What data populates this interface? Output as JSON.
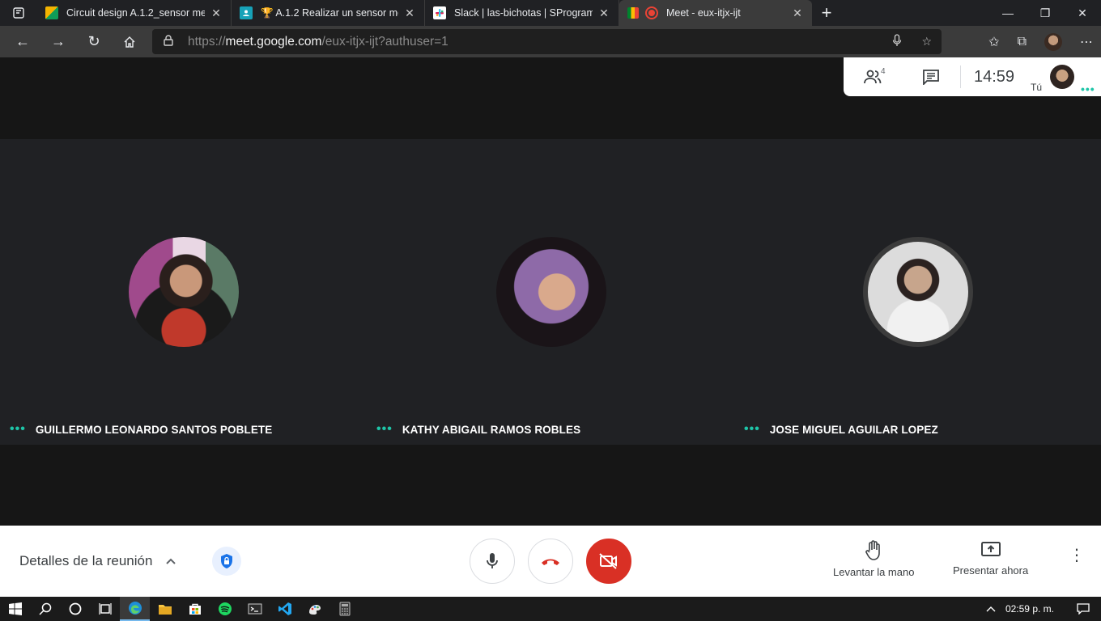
{
  "browser": {
    "tabs": [
      {
        "title": "Circuit design A.1.2_sensor medi",
        "favicon_color": "#f4b400",
        "active": false
      },
      {
        "title": "🏆 A.1.2 Realizar un sensor medi",
        "favicon_color": "#17a2b8",
        "active": false
      },
      {
        "title": "Slack | las-bichotas | SProgramab",
        "favicon_color": "#4a154b",
        "active": false
      },
      {
        "title": "Meet - eux-itjx-ijt",
        "favicon_color": "#ea4335",
        "active": true
      }
    ],
    "new_tab": "+",
    "url": {
      "scheme": "https://",
      "host": "meet.google.com",
      "path": "/eux-itjx-ijt?authuser=1"
    }
  },
  "meet": {
    "people_count": "4",
    "time": "14:59",
    "self_label": "Tú",
    "participants": [
      {
        "name": "GUILLERMO LEONARDO SANTOS POBLETE"
      },
      {
        "name": "KATHY ABIGAIL RAMOS ROBLES"
      },
      {
        "name": "JOSE MIGUEL AGUILAR LOPEZ"
      }
    ],
    "controls": {
      "details_label": "Detalles de la reunión",
      "raise_hand_label": "Levantar la mano",
      "present_label": "Presentar ahora"
    },
    "colors": {
      "accent_green": "#1ec5a8",
      "end_call_red": "#d93025",
      "shield_blue": "#1a73e8"
    }
  },
  "taskbar": {
    "clock": "02:59 p. m."
  }
}
